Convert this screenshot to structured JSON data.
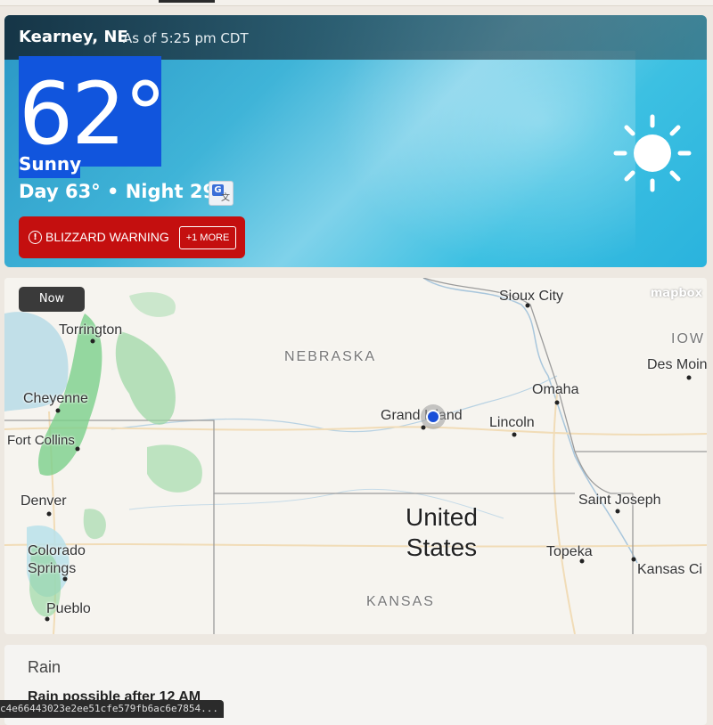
{
  "weather": {
    "location": "Kearney, NE",
    "as_of": "As of 5:25 pm CDT",
    "temperature": "62°",
    "phrase": "Sunny",
    "day_night": "Day 63° • Night 29°",
    "icon": "sun-icon",
    "alert": {
      "text": "BLIZZARD WARNING",
      "more": "+1 MORE",
      "color": "#c40f0f"
    },
    "highlight_color": "#1155dd"
  },
  "map": {
    "badge": "Now",
    "provider": "mapbox",
    "country": "United\nStates",
    "states": [
      "NEBRASKA",
      "KANSAS",
      "IOW"
    ],
    "cities": [
      "Sioux City",
      "Torrington",
      "Des Moin",
      "Omaha",
      "Cheyenne",
      "Grand Island",
      "Lincoln",
      "Fort Collins",
      "Denver",
      "Saint Joseph",
      "Colorado\nSprings",
      "Topeka",
      "Kansas Ci",
      "Pueblo"
    ]
  },
  "rain": {
    "title": "Rain",
    "subtitle": "Rain possible after 12 AM"
  },
  "status_bar": {
    "url": "c4e66443023e2ee51cfe579fb6ac6e7854..."
  }
}
